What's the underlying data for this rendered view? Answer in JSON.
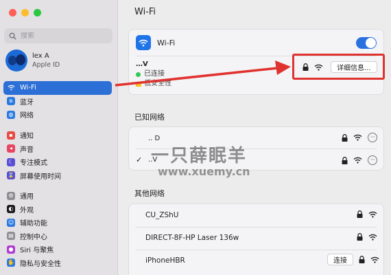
{
  "sidebar": {
    "search_placeholder": "搜索",
    "account": {
      "name": "lex A",
      "subtitle": "Apple ID"
    },
    "items": [
      {
        "label": "Wi-Fi",
        "icon": "wifi-icon",
        "color": "#2c6fd6",
        "active": true
      },
      {
        "label": "蓝牙",
        "icon": "bluetooth-icon",
        "color": "#2a7ae2"
      },
      {
        "label": "网络",
        "icon": "globe-icon",
        "color": "#2a7ae2"
      },
      {
        "label": "通知",
        "icon": "bell-icon",
        "color": "#e84a43"
      },
      {
        "label": "声音",
        "icon": "speaker-icon",
        "color": "#e84560"
      },
      {
        "label": "专注模式",
        "icon": "moon-icon",
        "color": "#5b4fd3"
      },
      {
        "label": "屏幕使用时间",
        "icon": "hourglass-icon",
        "color": "#5b4fd3"
      },
      {
        "label": "通用",
        "icon": "gear-icon",
        "color": "#8e8e93"
      },
      {
        "label": "外观",
        "icon": "appearance-icon",
        "color": "#1c1c1e"
      },
      {
        "label": "辅助功能",
        "icon": "accessibility-icon",
        "color": "#2a7ae2"
      },
      {
        "label": "控制中心",
        "icon": "control-center-icon",
        "color": "#8e8e93"
      },
      {
        "label": "Siri 与聚焦",
        "icon": "siri-icon",
        "color": "#b03bd6"
      },
      {
        "label": "隐私与安全性",
        "icon": "hand-icon",
        "color": "#2a7ae2"
      }
    ]
  },
  "main": {
    "title": "Wi-Fi",
    "wifi_label": "Wi-Fi",
    "toggle_on": true,
    "current_network": {
      "name": "…V",
      "status": "已连接",
      "security": "低安全性",
      "details_button": "详细信息..."
    },
    "known_title": "已知网络",
    "known_networks": [
      {
        "name": ".. D",
        "checked": false
      },
      {
        "name": "..V",
        "checked": true
      }
    ],
    "other_title": "其他网络",
    "other_networks": [
      {
        "name": "CU_ZShU",
        "button": ""
      },
      {
        "name": "DIRECT-8F-HP Laser 136w",
        "button": ""
      },
      {
        "name": "iPhoneHBR",
        "button": "连接"
      }
    ],
    "checkmark": "✓",
    "more_glyph": "···"
  },
  "watermark": {
    "line1": "一只薛眠羊",
    "line2": "www.xuemy.cn"
  },
  "colors": {
    "accent": "#2c6fd6",
    "annotation": "#e0322f",
    "connected_dot": "#34c759",
    "warning": "#f5c518"
  }
}
